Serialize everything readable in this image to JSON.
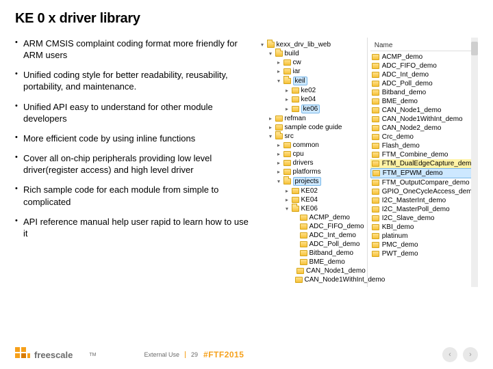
{
  "title": "KE 0 x driver library",
  "bullets": [
    "ARM CMSIS complaint coding format more friendly for  ARM users",
    "Unified coding style for better readability, reusability, portability, and maintenance.",
    "Unified API easy to understand for other module developers",
    "More efficient code by using inline functions",
    "Cover all  on-chip peripherals  providing low level driver(register access) and high level driver",
    "Rich sample code for each module from simple to complicated",
    "API reference manual help user rapid to learn how to use it"
  ],
  "tree": {
    "root": "kexx_drv_lib_web",
    "items": [
      {
        "d": 1,
        "exp": "▾",
        "label": "build",
        "open": true
      },
      {
        "d": 2,
        "exp": "▸",
        "label": "cw"
      },
      {
        "d": 2,
        "exp": "▸",
        "label": "iar"
      },
      {
        "d": 2,
        "exp": "▾",
        "label": "keil",
        "open": true,
        "sel": true
      },
      {
        "d": 3,
        "exp": "▸",
        "label": "ke02"
      },
      {
        "d": 3,
        "exp": "▸",
        "label": "ke04"
      },
      {
        "d": 3,
        "exp": "▸",
        "label": "ke06",
        "sel": true
      },
      {
        "d": 1,
        "exp": "▸",
        "label": "refman"
      },
      {
        "d": 1,
        "exp": "▸",
        "label": "sample code guide"
      },
      {
        "d": 1,
        "exp": "▾",
        "label": "src",
        "open": true
      },
      {
        "d": 2,
        "exp": "▸",
        "label": "common"
      },
      {
        "d": 2,
        "exp": "▸",
        "label": "cpu"
      },
      {
        "d": 2,
        "exp": "▸",
        "label": "drivers"
      },
      {
        "d": 2,
        "exp": "▸",
        "label": "platforms"
      },
      {
        "d": 2,
        "exp": "▾",
        "label": "projects",
        "open": true,
        "sel": true
      },
      {
        "d": 3,
        "exp": "▸",
        "label": "KE02"
      },
      {
        "d": 3,
        "exp": "▸",
        "label": "KE04"
      },
      {
        "d": 3,
        "exp": "▾",
        "label": "KE06",
        "open": true
      },
      {
        "d": 4,
        "exp": "",
        "label": "ACMP_demo"
      },
      {
        "d": 4,
        "exp": "",
        "label": "ADC_FIFO_demo"
      },
      {
        "d": 4,
        "exp": "",
        "label": "ADC_Int_demo"
      },
      {
        "d": 4,
        "exp": "",
        "label": "ADC_Poll_demo"
      },
      {
        "d": 4,
        "exp": "",
        "label": "Bitband_demo"
      },
      {
        "d": 4,
        "exp": "",
        "label": "BME_demo"
      },
      {
        "d": 4,
        "exp": "",
        "label": "CAN_Node1_demo"
      },
      {
        "d": 4,
        "exp": "",
        "label": "CAN_Node1WithInt_demo"
      }
    ]
  },
  "right_col": {
    "header": "Name",
    "items": [
      {
        "label": "ACMP_demo"
      },
      {
        "label": "ADC_FIFO_demo"
      },
      {
        "label": "ADC_Int_demo"
      },
      {
        "label": "ADC_Poll_demo"
      },
      {
        "label": "Bitband_demo"
      },
      {
        "label": "BME_demo"
      },
      {
        "label": "CAN_Node1_demo"
      },
      {
        "label": "CAN_Node1WithInt_demo"
      },
      {
        "label": "CAN_Node2_demo"
      },
      {
        "label": "Crc_demo"
      },
      {
        "label": "Flash_demo"
      },
      {
        "label": "FTM_Combine_demo"
      },
      {
        "label": "FTM_DualEdgeCapture_demo",
        "hl": true
      },
      {
        "label": "FTM_EPWM_demo",
        "selr": true
      },
      {
        "label": "FTM_OutputCompare_demo"
      },
      {
        "label": "GPIO_OneCycleAccess_demo"
      },
      {
        "label": "I2C_MasterInt_demo"
      },
      {
        "label": "I2C_MasterPoll_demo"
      },
      {
        "label": "I2C_Slave_demo"
      },
      {
        "label": "KBI_demo"
      },
      {
        "label": "platinum"
      },
      {
        "label": "PMC_demo"
      },
      {
        "label": "PWT_demo"
      }
    ]
  },
  "footer": {
    "brand": "freescale",
    "tm": "TM",
    "external": "External Use",
    "page": "29",
    "hashtag": "#FTF2015"
  },
  "nav": {
    "prev": "‹",
    "next": "›"
  }
}
